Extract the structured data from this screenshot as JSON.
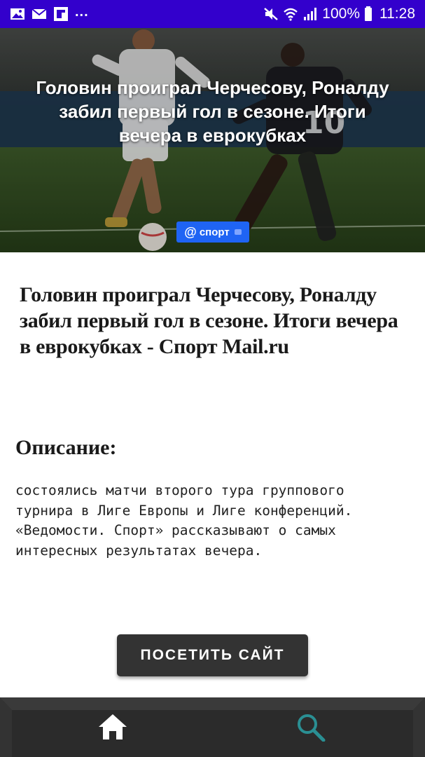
{
  "status_bar": {
    "overflow": "...",
    "battery": "100%",
    "time": "11:28"
  },
  "hero": {
    "title": "Головин проиграл Черчесову, Роналду забил первый гол в сезоне. Итоги вечера в еврокубках",
    "badge_symbol": "@",
    "badge_label": "спорт"
  },
  "article": {
    "title": "Головин проиграл Черчесову, Роналду забил первый гол в сезоне. Итоги вечера в еврокубках - Спорт Mail.ru",
    "description_heading": "Описание:",
    "description": "состоялись матчи второго тура группового турнира в Лиге Европы и Лиге конференций. «Ведомости. Спорт» рассказывают о самых интересных результатах вечера."
  },
  "actions": {
    "visit_label": "ПОСЕТИТЬ САЙТ"
  },
  "nav": {
    "home_icon": "home-icon",
    "search_icon": "search-icon"
  },
  "colors": {
    "status_bar": "#3300cc",
    "badge": "#1f64f4",
    "button": "#333333",
    "nav_bar": "#2b2b2b",
    "search_icon": "#2a8f93"
  }
}
